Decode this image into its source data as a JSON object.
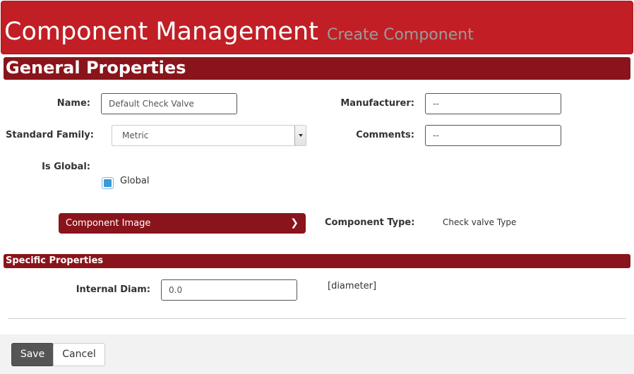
{
  "header": {
    "title": "Component Management",
    "subtitle": "Create Component"
  },
  "general": {
    "section_title": "General Properties",
    "name_label": "Name:",
    "name_value": "Default Check Valve",
    "manufacturer_label": "Manufacturer:",
    "manufacturer_value": "--",
    "standard_family_label": "Standard Family:",
    "standard_family_value": "Metric",
    "comments_label": "Comments:",
    "comments_value": "--",
    "is_global_label": "Is Global:",
    "global_checkbox_label": "Global",
    "global_checked": true,
    "component_image_label": "Component Image",
    "component_type_label": "Component Type:",
    "component_type_value": "Check valve Type"
  },
  "specific": {
    "section_title": "Specific Properties",
    "internal_diam_label": "Internal Diam:",
    "internal_diam_value": "0.0",
    "internal_diam_unit": "[diameter]"
  },
  "footer": {
    "save_label": "Save",
    "cancel_label": "Cancel"
  },
  "colors": {
    "header_red": "#c11f25",
    "section_red": "#8a141b",
    "checkbox_blue": "#3a9ad9"
  }
}
